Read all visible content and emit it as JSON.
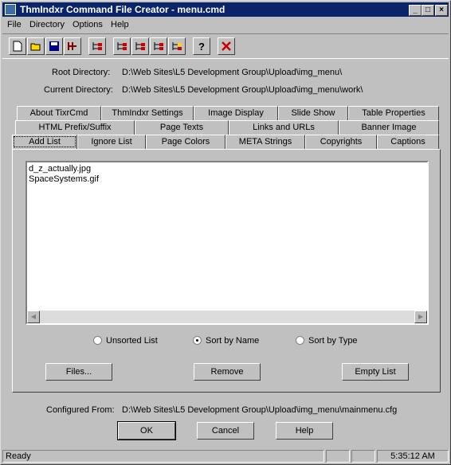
{
  "window": {
    "title": "ThmIndxr Command File Creator - menu.cmd"
  },
  "menu": [
    "File",
    "Directory",
    "Options",
    "Help"
  ],
  "toolbar_icons": [
    "new-file-icon",
    "open-folder-icon",
    "save-icon",
    "tool-icon",
    "tree-icon",
    "tree-add-icon",
    "tree-edit-icon",
    "tree-remove-icon",
    "tree-run-icon",
    "help-icon",
    "close-x-icon"
  ],
  "fields": {
    "root_label": "Root Directory:",
    "root_value": "D:\\Web Sites\\L5 Development Group\\Upload\\img_menu\\",
    "current_label": "Current Directory:",
    "current_value": "D:\\Web Sites\\L5 Development Group\\Upload\\img_menu\\work\\",
    "configured_label": "Configured From:",
    "configured_value": "D:\\Web Sites\\L5 Development Group\\Upload\\img_menu\\mainmenu.cfg"
  },
  "tabs": {
    "row1": [
      "About TixrCmd",
      "ThmIndxr Settings",
      "Image Display",
      "Slide Show",
      "Table Properties"
    ],
    "row2": [
      "HTML Prefix/Suffix",
      "Page Texts",
      "Links and URLs",
      "Banner Image"
    ],
    "row3": [
      "Add List",
      "Ignore List",
      "Page Colors",
      "META Strings",
      "Copyrights",
      "Captions"
    ],
    "active": "Add List"
  },
  "list_items": [
    "d_z_actually.jpg",
    "SpaceSystems.gif"
  ],
  "sort_options": {
    "unsorted": "Unsorted List",
    "by_name": "Sort by Name",
    "by_type": "Sort by Type",
    "selected": "Sort by Name"
  },
  "panel_buttons": {
    "files": "Files...",
    "remove": "Remove",
    "empty": "Empty List"
  },
  "dialog_buttons": {
    "ok": "OK",
    "cancel": "Cancel",
    "help": "Help"
  },
  "status": {
    "text": "Ready",
    "time": "5:35:12 AM"
  }
}
